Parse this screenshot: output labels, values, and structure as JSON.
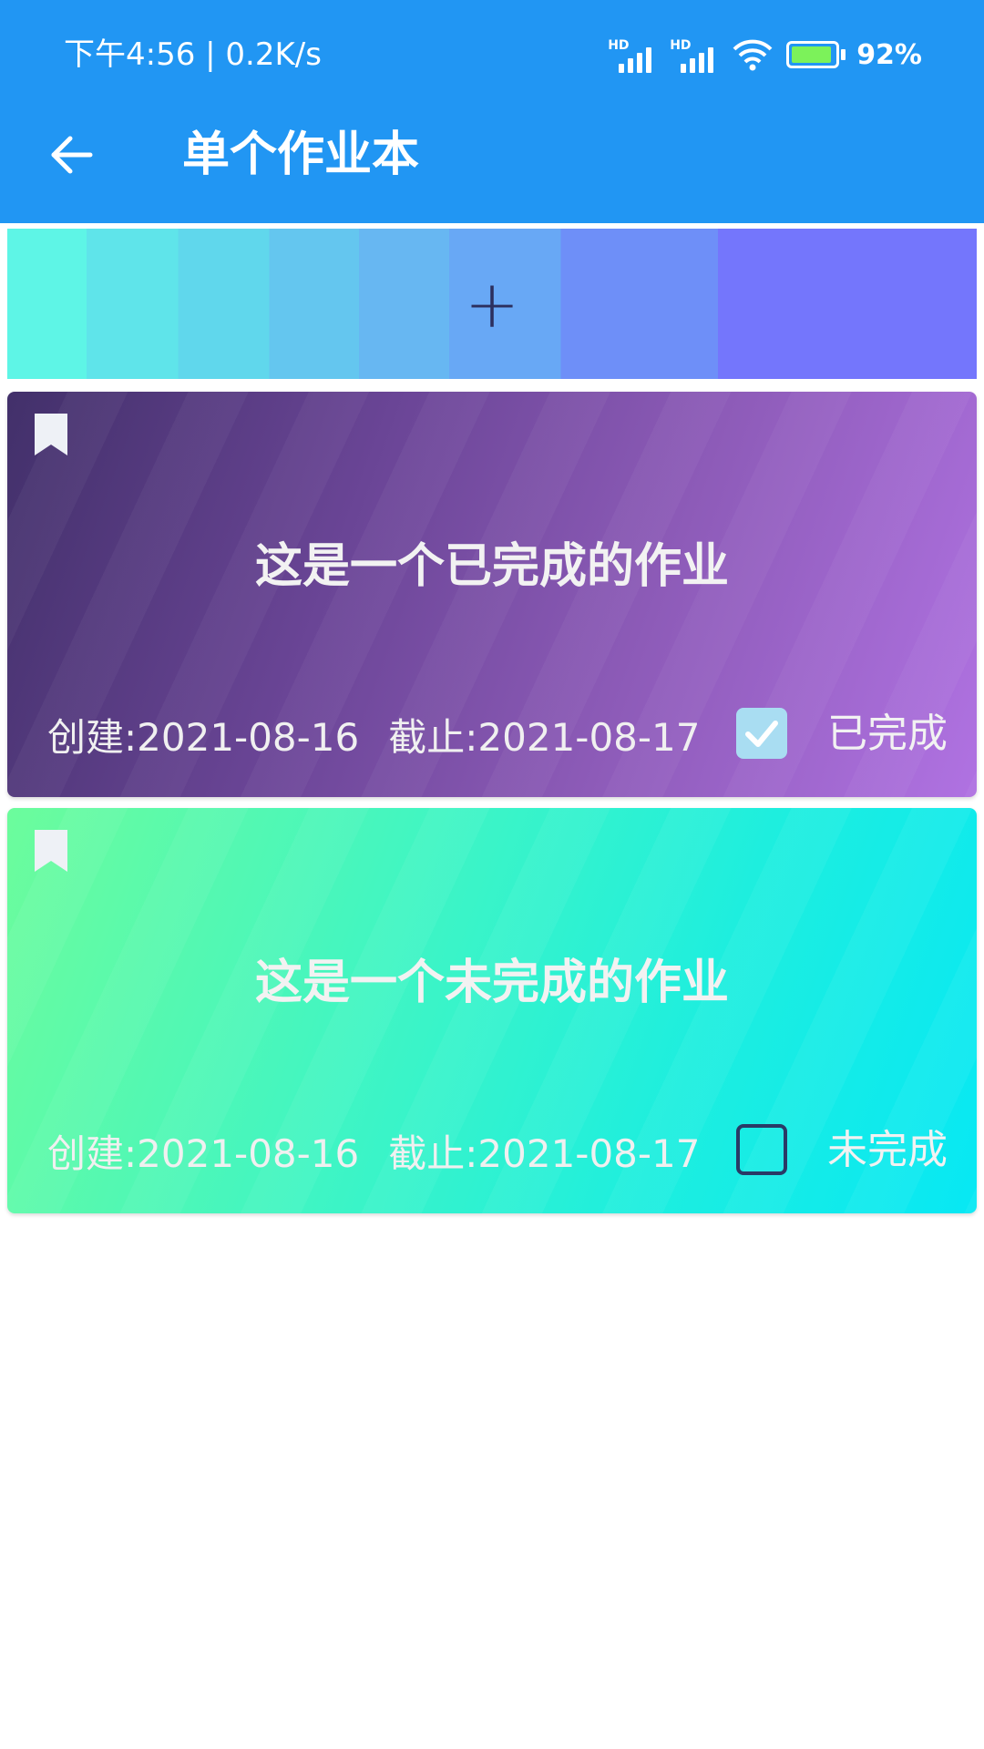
{
  "statusbar": {
    "time": "下午4:56 | 0.2K/s",
    "hd1": "HD",
    "hd2": "HD",
    "battery_pct": "92%",
    "icons": [
      "signal-hd-icon",
      "signal-hd-icon",
      "wifi-icon",
      "battery-charging-icon"
    ]
  },
  "appbar": {
    "title": "单个作业本",
    "back_icon": "arrow-left-icon"
  },
  "add_banner": {
    "plus": "+"
  },
  "cards": [
    {
      "title": "这是一个已完成的作业",
      "created": "创建:2021-08-16",
      "deadline": "截止:2021-08-17",
      "checked": true,
      "status": "已完成"
    },
    {
      "title": "这是一个未完成的作业",
      "created": "创建:2021-08-16",
      "deadline": "截止:2021-08-17",
      "checked": false,
      "status": "未完成"
    }
  ],
  "colors": {
    "primary": "#2196F3",
    "done_card_start": "#42306A",
    "done_card_end": "#B072E2",
    "todo_card_start": "#6CFC9C",
    "todo_card_end": "#07E8F4"
  }
}
